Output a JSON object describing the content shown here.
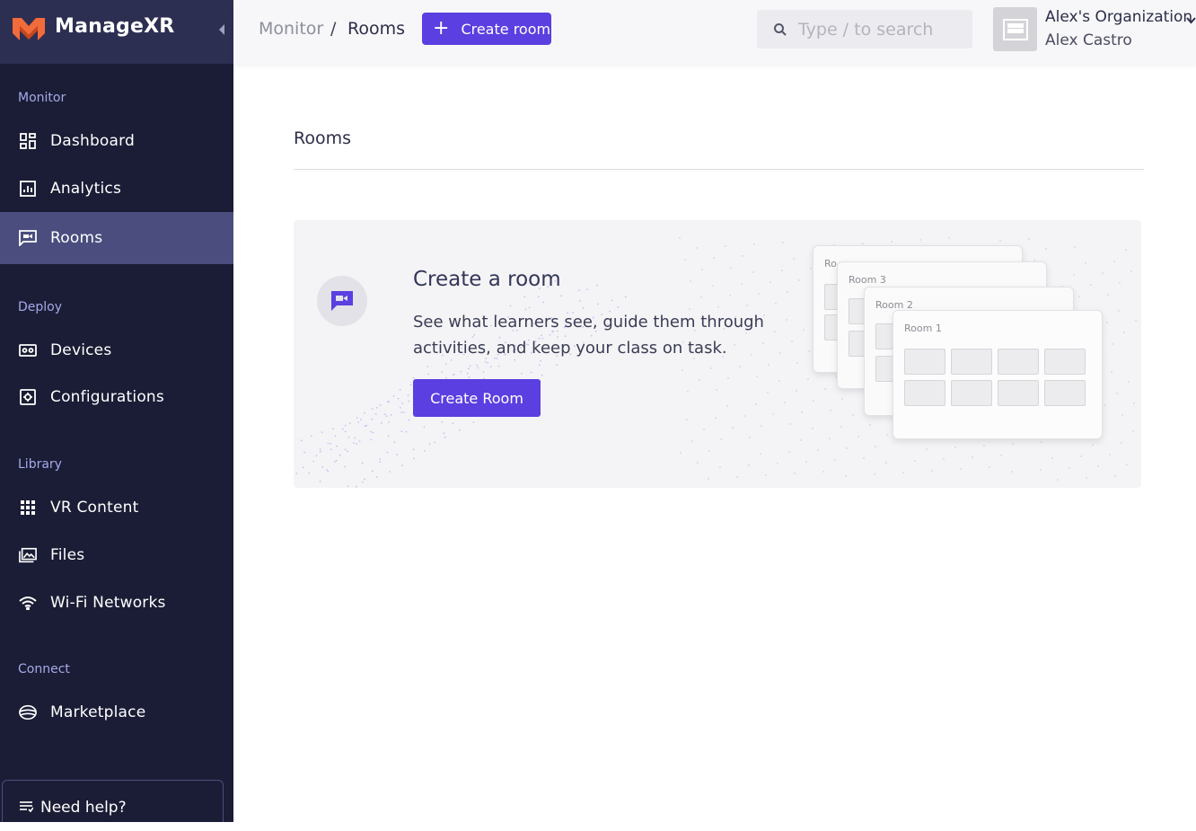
{
  "app": {
    "brand_name": "ManageXR",
    "brand_color": "#f26b3a",
    "accent": "#5b3fe0"
  },
  "sidebar": {
    "sections": [
      {
        "label": "Monitor"
      },
      {
        "label": "Deploy"
      },
      {
        "label": "Library"
      },
      {
        "label": "Connect"
      }
    ],
    "items": [
      {
        "label": "Dashboard",
        "icon": "dashboard-icon"
      },
      {
        "label": "Analytics",
        "icon": "analytics-icon"
      },
      {
        "label": "Rooms",
        "icon": "rooms-icon",
        "active": true
      },
      {
        "label": "Devices",
        "icon": "headset-icon"
      },
      {
        "label": "Configurations",
        "icon": "gear-icon"
      },
      {
        "label": "VR Content",
        "icon": "grid-icon"
      },
      {
        "label": "Files",
        "icon": "image-icon"
      },
      {
        "label": "Wi-Fi Networks",
        "icon": "wifi-icon"
      },
      {
        "label": "Marketplace",
        "icon": "marketplace-icon"
      }
    ],
    "help_label": "Need help?"
  },
  "topbar": {
    "breadcrumb": {
      "parent": "Monitor",
      "separator": "/",
      "current": "Rooms"
    },
    "create_button_label": "Create room",
    "search_placeholder": "Type / to search",
    "org_name": "Alex's Organization",
    "user_name": "Alex Castro"
  },
  "main": {
    "page_title": "Rooms",
    "hero": {
      "title": "Create a room",
      "description": "See what learners see, guide them through activities, and keep your class on task.",
      "button_label": "Create Room",
      "room_cards": [
        "Room 1",
        "Room 2",
        "Room 3",
        "Ro"
      ]
    }
  }
}
